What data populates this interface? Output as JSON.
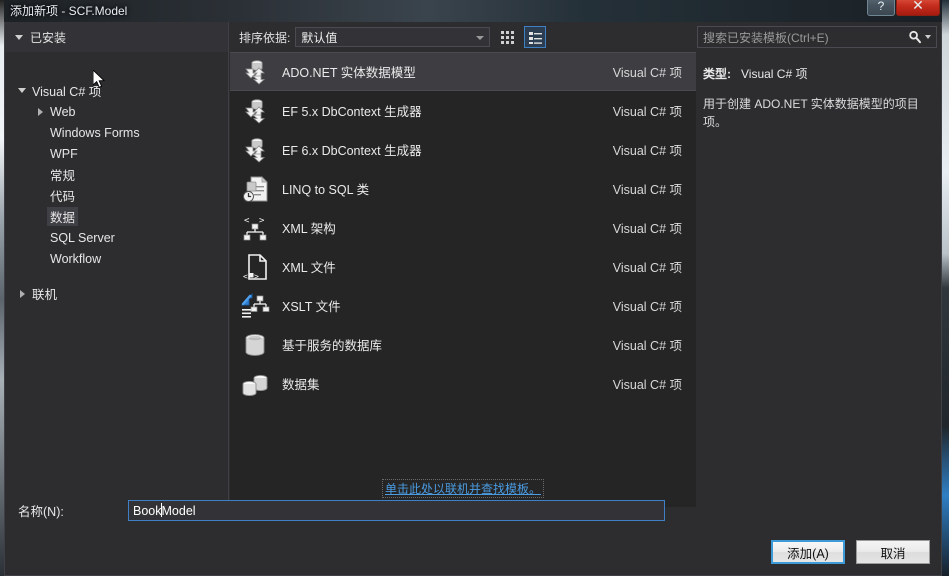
{
  "window": {
    "title": "添加新项 - SCF.Model",
    "help_button": "?",
    "close_button": "✕"
  },
  "topbar": {
    "installed_label": "已安装",
    "sort_label": "排序依据:",
    "sort_value": "默认值",
    "tile_view_icon": "tile-view-icon",
    "list_view_icon": "list-view-icon",
    "search_placeholder": "搜索已安装模板(Ctrl+E)",
    "search_value": "",
    "search_icon": "search-icon"
  },
  "tree": {
    "items": [
      {
        "label": "Visual C# 项",
        "indent": 0,
        "state": "expanded",
        "selected": false
      },
      {
        "label": "Web",
        "indent": 1,
        "state": "collapsed",
        "selected": false
      },
      {
        "label": "Windows Forms",
        "indent": 1,
        "state": "leaf",
        "selected": false
      },
      {
        "label": "WPF",
        "indent": 1,
        "state": "leaf",
        "selected": false
      },
      {
        "label": "常规",
        "indent": 1,
        "state": "leaf",
        "selected": false
      },
      {
        "label": "代码",
        "indent": 1,
        "state": "leaf",
        "selected": false
      },
      {
        "label": "数据",
        "indent": 1,
        "state": "leaf",
        "selected": true
      },
      {
        "label": "SQL Server",
        "indent": 1,
        "state": "leaf",
        "selected": false
      },
      {
        "label": "Workflow",
        "indent": 1,
        "state": "leaf",
        "selected": false
      },
      {
        "label": "联机",
        "indent": 0,
        "state": "collapsed",
        "selected": false,
        "spacer_before": true
      }
    ]
  },
  "templates": {
    "items": [
      {
        "name": "ADO.NET 实体数据模型",
        "kind": "Visual C# 项",
        "icon": "entity-data-model-icon",
        "selected": true
      },
      {
        "name": "EF 5.x DbContext 生成器",
        "kind": "Visual C# 项",
        "icon": "entity-data-model-icon",
        "selected": false
      },
      {
        "name": "EF 6.x DbContext 生成器",
        "kind": "Visual C# 项",
        "icon": "entity-data-model-icon",
        "selected": false
      },
      {
        "name": "LINQ to SQL 类",
        "kind": "Visual C# 项",
        "icon": "linq-to-sql-icon",
        "selected": false
      },
      {
        "name": "XML 架构",
        "kind": "Visual C# 项",
        "icon": "xml-schema-icon",
        "selected": false
      },
      {
        "name": "XML 文件",
        "kind": "Visual C# 项",
        "icon": "xml-file-icon",
        "selected": false
      },
      {
        "name": "XSLT 文件",
        "kind": "Visual C# 项",
        "icon": "xslt-file-icon",
        "selected": false
      },
      {
        "name": "基于服务的数据库",
        "kind": "Visual C# 项",
        "icon": "database-icon",
        "selected": false
      },
      {
        "name": "数据集",
        "kind": "Visual C# 项",
        "icon": "dataset-icon",
        "selected": false
      }
    ],
    "online_link": "单击此处以联机并查找模板。"
  },
  "details": {
    "type_label": "类型:",
    "type_value": "Visual C# 项",
    "description": "用于创建 ADO.NET 实体数据模型的项目项。"
  },
  "footer": {
    "name_label": "名称(N):",
    "name_value_before_caret": "Book",
    "name_value_after_caret": "Model",
    "add_button": "添加(A)",
    "cancel_button": "取消"
  },
  "colors": {
    "dialog_bg": "#2d2d30",
    "list_bg": "#252526",
    "selection_bg": "#3d3d42",
    "accent": "#3e7fc6",
    "link": "#4a9be0",
    "close_red": "#c62f1e"
  }
}
